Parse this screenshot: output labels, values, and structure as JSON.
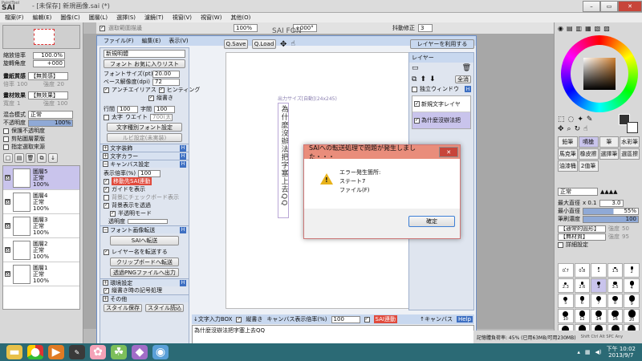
{
  "app": {
    "logo_top": "PaintTool",
    "logo_main": "SAI",
    "title": "- [未保存] 新規画像.sai (*)"
  },
  "menubar": [
    "檔案(F)",
    "編輯(E)",
    "圖像(C)",
    "圖層(L)",
    "選擇(S)",
    "濾鏡(T)",
    "視窗(V)",
    "視窗(W)",
    "其他(O)"
  ],
  "toolbar": {
    "stabilizer_label": "抖動修正",
    "stabilizer_value": "3",
    "zoom_value": "100%",
    "angle_value": "+000°",
    "selection_hide": "選取範圍描邊"
  },
  "left_panel": {
    "zoom_label": "縮放倍率",
    "zoom_value": "100.0%",
    "rotate_label": "旋轉角度",
    "rotate_value": "+000",
    "paper_texture_label": "畫紙質感",
    "paper_texture_value": "【無質感】",
    "paper_scale_label": "倍率",
    "paper_scale_value": "100",
    "paper_strength_label": "強度",
    "paper_strength_value": "20",
    "effect_label": "畫材效果",
    "effect_value": "【無效果】",
    "effect_width_label": "寬度",
    "effect_width_value": "1",
    "effect_strength_label": "強度",
    "effect_strength_value": "100",
    "blend_label": "混合模式",
    "blend_value": "正常",
    "opacity_label": "不透明度",
    "opacity_value": "100%",
    "checks": [
      "保護不透明度",
      "剪貼圖層蒙版",
      "指定選取來源"
    ],
    "layers": [
      {
        "name": "圖層5",
        "mode": "正常",
        "opacity": "100%",
        "selected": true
      },
      {
        "name": "圖層4",
        "mode": "正常",
        "opacity": "100%",
        "selected": false
      },
      {
        "name": "圖層3",
        "mode": "正常",
        "opacity": "100%",
        "selected": false
      },
      {
        "name": "圖層2",
        "mode": "正常",
        "opacity": "100%",
        "selected": false
      },
      {
        "name": "圖層1",
        "mode": "正常",
        "opacity": "100%",
        "selected": false
      }
    ]
  },
  "plugin": {
    "menu": [
      "ファイル(F)",
      "編集(E)",
      "表示(V)"
    ],
    "style_select": "新規明體",
    "font_fav_button": "フォント お気に入りリスト",
    "font_size_label": "フォントサイズ(pt)",
    "font_size_value": "20.00",
    "base_res_label": "ベース解像度(dpi)",
    "base_res_value": "72",
    "antialias": "アンチエイリアス",
    "hinting": "ヒンティング",
    "vertical": "縦書き",
    "line_spacing_label": "行間",
    "line_spacing_value": "100",
    "char_spacing_label": "字間",
    "char_spacing_value": "100",
    "bold": "太字",
    "weight_label": "ウエイト",
    "weight_value": "700(太",
    "font_setting_button": "文字種別フォント設定",
    "ruby_button": "ルビ設定(未実装)",
    "sections": {
      "decoration": "文字装飾",
      "color": "文字カラー",
      "canvas": "キャンバス設定",
      "font_transfer": "フォント画像転送",
      "other_settings": "環境設定"
    },
    "display_zoom_label": "表示倍率(%)",
    "display_zoom_value": "100",
    "sai_link": "移動先SAI連動",
    "show_guide": "ガイドを表示",
    "bg_check": "背景にチェックボード表示",
    "bg_transparent": "背景表示を透過",
    "semi_transparent": "半透明モード",
    "transparency_label": "透明度",
    "send_to_sai_button": "SAIへ転送",
    "auto_layer_name": "レイヤー名を転送する",
    "clipboard_button": "クリップボードへ転送",
    "png_button": "透過PNGファイルへ出力",
    "vertical_symbol": "縦書き時の記号処理",
    "others": "その他",
    "style_save": "スタイル保存",
    "style_read": "スタイル読込"
  },
  "canvas": {
    "header_logo": "SAI FON",
    "save_button": "Q.Save",
    "load_button": "Q.Load",
    "layer_use_button": "レイヤーを利用する",
    "output_size": "出力サイズ[自動](24x245)",
    "vertical_text": "為什麼沒辦法把字塞上去QQ",
    "layer_panel_title": "レイヤー",
    "layer_all_select": "全消",
    "independent_window": "独立ウィンドウ",
    "text_layers": [
      "新規文字レイヤ",
      "為什麼沒辦法把"
    ]
  },
  "bottom": {
    "text_input_box": "↓文字入力BOX",
    "vertical_check": "縦書き",
    "canvas_zoom_label": "キャンバス表示倍率(%)",
    "canvas_zoom_value": "100",
    "sai_link": "SAI連動",
    "to_canvas": "↑キャンバス",
    "help": "Help",
    "text_content": "為什麼沒辦法把字塞上去QQ"
  },
  "dialog": {
    "title": "SAIへの転送処理で問題が発生しました・・・",
    "line1": "エラー発生箇所:",
    "line2": "ステート7",
    "line3": "ファイル(F)",
    "ok": "確定"
  },
  "right_panel": {
    "tools": [
      "鉛筆",
      "噴槍",
      "筆",
      "水彩筆",
      "馬克筆",
      "橡皮擦",
      "選擇筆",
      "選區擦",
      "油漆桶",
      "2值筆"
    ],
    "blend_value": "正常",
    "max_diameter_label": "最大直徑",
    "max_diameter_x": "x 0.1",
    "max_diameter_value": "3.0",
    "min_size_label": "最小直徑",
    "min_size_value": "55%",
    "density_label": "筆刷濃度",
    "density_value": "100",
    "shape_value": "【通常的圓形】",
    "shape_strength_label": "強度",
    "shape_strength_value": "50",
    "texture_value": "【無材質】",
    "texture_strength_label": "強度",
    "texture_strength_value": "95",
    "detail_label": "詳細設定",
    "size_grid": [
      [
        "0.7",
        "0.8",
        "1",
        "1.5",
        "2"
      ],
      [
        "2.3",
        "2.6",
        "3",
        "3.5",
        "4"
      ],
      [
        "5",
        "6",
        "7",
        "8",
        "9"
      ],
      [
        "10",
        "12",
        "14",
        "16",
        "20"
      ],
      [
        "25",
        "30",
        "35",
        "40",
        "50"
      ]
    ]
  },
  "status": {
    "memory": "記憶體負荷率: 45% (已用63MB/可用230MB)",
    "keys": "Shift Ctrl Alt SPC Any"
  },
  "taskbar": {
    "time": "下午 10:02",
    "date": "2013/9/7"
  },
  "colors": {
    "menu_bg": "#c8d8ef",
    "panel_blue": "#6d8fc7",
    "selected_layer": "#c9c4ec",
    "dialog_title": "#e98d7b",
    "taskbar": "#2b6a75"
  }
}
